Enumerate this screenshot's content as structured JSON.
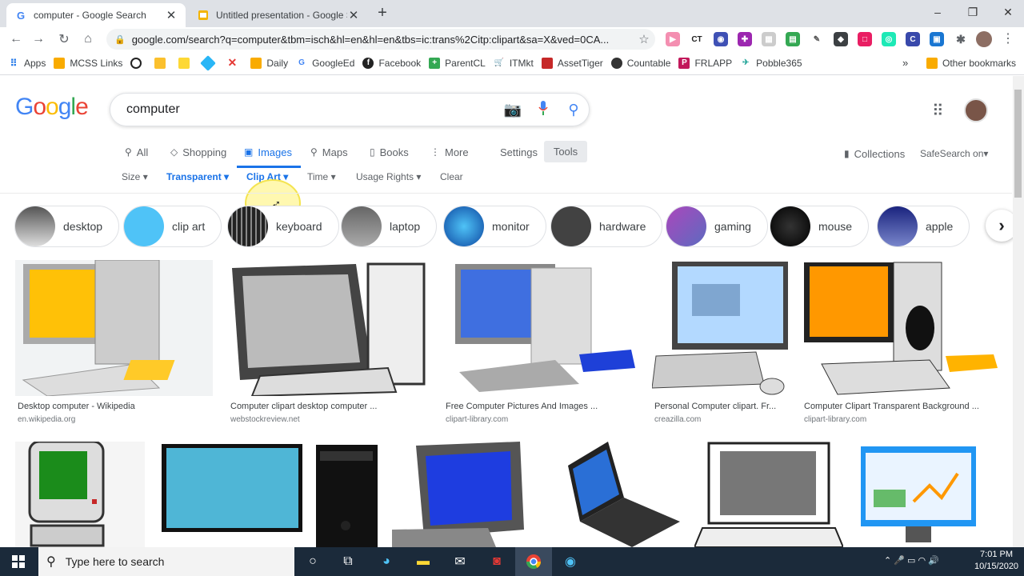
{
  "browser": {
    "tabs": [
      {
        "title": "computer - Google Search",
        "favicon": "G",
        "active": true
      },
      {
        "title": "Untitled presentation - Google Sl",
        "favicon": "slides-icon",
        "active": false
      }
    ],
    "new_tab": "+",
    "window_controls": {
      "min": "–",
      "max": "❐",
      "close": "✕"
    },
    "url": "google.com/search?q=computer&tbm=isch&hl=en&hl=en&tbs=ic:trans%2Citp:clipart&sa=X&ved=0CA...",
    "bookmarks": [
      "Apps",
      "MCSS Links",
      "Daily",
      "GoogleEd",
      "Facebook",
      "ParentCL",
      "ITMkt",
      "AssetTiger",
      "Countable",
      "FRLAPP",
      "Pobble365"
    ],
    "other_bookmarks": "Other bookmarks",
    "overflow": "»"
  },
  "google": {
    "logo": [
      "G",
      "o",
      "o",
      "g",
      "l",
      "e"
    ],
    "logo_colors": [
      "#4285f4",
      "#ea4335",
      "#fbbc05",
      "#4285f4",
      "#34a853",
      "#ea4335"
    ],
    "query": "computer",
    "nav": {
      "all": "All",
      "shopping": "Shopping",
      "images": "Images",
      "maps": "Maps",
      "books": "Books",
      "more": "More",
      "settings": "Settings",
      "tools": "Tools"
    },
    "collections": "Collections",
    "safesearch": "SafeSearch on",
    "filters": {
      "size": "Size",
      "transparent": "Transparent",
      "clipart": "Clip Art",
      "time": "Time",
      "usage": "Usage Rights",
      "clear": "Clear"
    },
    "chips": [
      "desktop",
      "clip art",
      "keyboard",
      "laptop",
      "monitor",
      "hardware",
      "gaming",
      "mouse",
      "apple"
    ],
    "results": [
      {
        "title": "Desktop computer - Wikipedia",
        "source": "en.wikipedia.org"
      },
      {
        "title": "Computer clipart desktop computer ...",
        "source": "webstockreview.net"
      },
      {
        "title": "Free Computer Pictures And Images ...",
        "source": "clipart-library.com"
      },
      {
        "title": "Personal Computer clipart. Fr...",
        "source": "creazilla.com"
      },
      {
        "title": "Computer Clipart Transparent Background ...",
        "source": "clipart-library.com"
      }
    ]
  },
  "taskbar": {
    "search_placeholder": "Type here to search",
    "time": "7:01 PM",
    "date": "10/15/2020"
  }
}
